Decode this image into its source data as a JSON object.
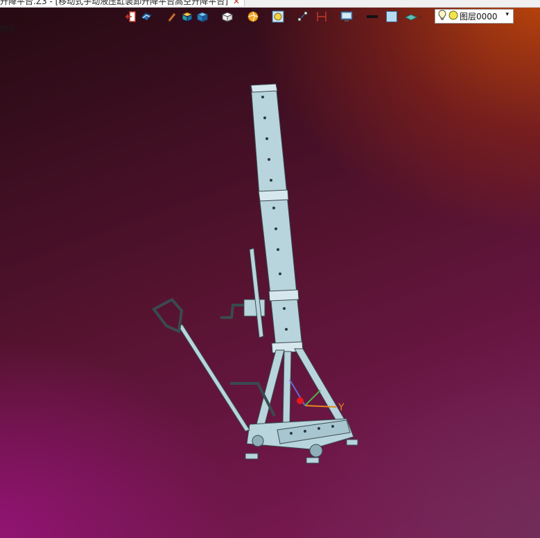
{
  "document_tab": {
    "title": "升降平台.Z3 - [移动式手动液压缸装卸升降平台高空升降平台]",
    "close_glyph": "✕"
  },
  "toolbar": {
    "icons": [
      "exit-icon",
      "view-orient-icon",
      "pencil-icon",
      "box-shade-icon",
      "cube-view-icon",
      "wireframe-cube-icon",
      "sun-render-icon",
      "zoom-fit-icon",
      "snap-icon",
      "dimension-icon",
      "display-icon",
      "line-color-icon",
      "fill-color-icon",
      "layer-plane-icon"
    ],
    "dropdown_glyph": "⌄"
  },
  "layer": {
    "value": "图层0000",
    "arrow": "▾"
  },
  "hint_text": "提示:",
  "axis": {
    "y_label": "Y"
  },
  "colors": {
    "toolbar_bg": "#f0f0f0",
    "model_fill": "#b8d4dc",
    "model_stroke": "#3a4a50",
    "axis_orange": "#e08a1e",
    "axis_green": "#4fb04a",
    "axis_blue": "#6a6ad8",
    "marker_red": "#e41a1a"
  }
}
